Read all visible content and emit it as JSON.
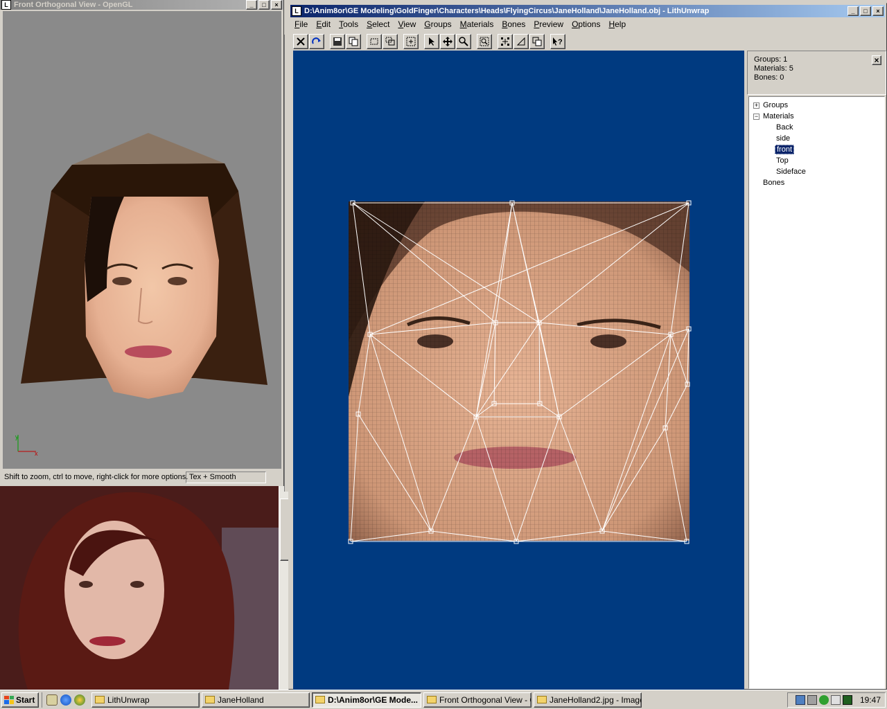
{
  "gl_window": {
    "title": "Front Orthogonal View - OpenGL",
    "axes": {
      "x": "x",
      "y": "y"
    },
    "status_hint": "Shift to zoom, ctrl to move, right-click for more options.",
    "render_mode": "Tex + Smooth"
  },
  "lithunwrap": {
    "title": "D:\\Anim8or\\GE Modeling\\GoldFinger\\Characters\\Heads\\FlyingCircus\\JaneHolland\\JaneHolland.obj - LithUnwrap",
    "menu": [
      {
        "label": "File",
        "key": "F",
        "rest": "ile"
      },
      {
        "label": "Edit",
        "key": "E",
        "rest": "dit"
      },
      {
        "label": "Tools",
        "key": "T",
        "rest": "ools"
      },
      {
        "label": "Select",
        "key": "S",
        "rest": "elect"
      },
      {
        "label": "View",
        "key": "V",
        "rest": "iew"
      },
      {
        "label": "Groups",
        "key": "G",
        "rest": "roups"
      },
      {
        "label": "Materials",
        "key": "M",
        "rest": "aterials"
      },
      {
        "label": "Bones",
        "key": "B",
        "rest": "ones"
      },
      {
        "label": "Preview",
        "key": "P",
        "rest": "review"
      },
      {
        "label": "Options",
        "key": "O",
        "rest": "ptions"
      },
      {
        "label": "Help",
        "key": "H",
        "rest": "elp"
      }
    ],
    "toolbar": [
      "close-tool-icon",
      "redo-icon",
      "save-icon",
      "copy-icon",
      "rect-select-icon",
      "lasso-select-icon",
      "fit-view-icon",
      "pointer-icon",
      "move-icon",
      "zoom-icon",
      "zoom-region-icon",
      "vertex-mode-icon",
      "face-mode-icon",
      "group-mode-icon",
      "context-help-icon"
    ],
    "info": {
      "groups": "Groups: 1",
      "materials": "Materials: 5",
      "bones": "Bones: 0"
    },
    "tree": {
      "groups": "Groups",
      "materials": "Materials",
      "material_items": [
        "Back",
        "side",
        "front",
        "Top",
        "Sideface"
      ],
      "selected": "front",
      "bones": "Bones"
    }
  },
  "taskbar": {
    "start": "Start",
    "tasks": [
      {
        "label": "LithUnwrap",
        "pressed": false
      },
      {
        "label": "JaneHolland",
        "pressed": false
      },
      {
        "label": "D:\\Anim8or\\GE Mode...",
        "pressed": true
      },
      {
        "label": "Front Orthogonal View - O...",
        "pressed": false
      },
      {
        "label": "JaneHolland2.jpg - Image ...",
        "pressed": false
      }
    ],
    "clock": "19:47"
  },
  "colors": {
    "uv_background": "#003a80",
    "title_active": "#0a246a",
    "gl_background": "#8a8a8a"
  }
}
